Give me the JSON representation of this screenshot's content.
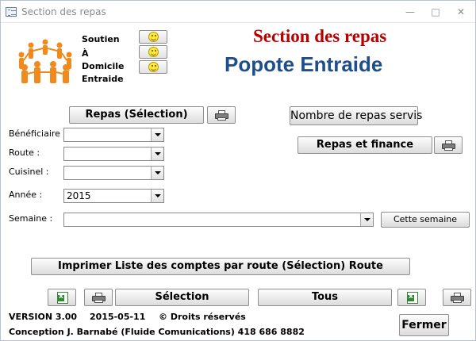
{
  "window": {
    "title": "Section des repas",
    "minimize_glyph": "—",
    "maximize_glyph": "□",
    "close_glyph": "✕"
  },
  "org": {
    "lines": [
      "Soutien",
      "À",
      "Domicile",
      "Entraide"
    ]
  },
  "header": {
    "title": "Section des repas",
    "subtitle": "Popote Entraide"
  },
  "buttons": {
    "repas_selection": "Repas (Sélection)",
    "nombre_repas": "Nombre de repas servis",
    "repas_finance": "Repas et finance",
    "cette_semaine": "Cette semaine",
    "imprimer_liste": "Imprimer Liste des comptes par route (Sélection) Route",
    "selection": "Sélection",
    "tous": "Tous",
    "fermer": "Fermer"
  },
  "filters": {
    "beneficiaire": {
      "label": "Bénéficiaire :",
      "value": ""
    },
    "route": {
      "label": "Route :",
      "value": ""
    },
    "cuisinel": {
      "label": "Cuisinel :",
      "value": ""
    },
    "annee": {
      "label": "Année :",
      "value": "2015"
    },
    "semaine": {
      "label": "Semaine :",
      "value": ""
    }
  },
  "footer": {
    "version": "VERSION 3.00",
    "date": "2015-05-11",
    "rights": "© Droits réservés",
    "credit": "Conception J. Barnabé (Fluide Comunications) 418 686 8882"
  },
  "colors": {
    "title_red": "#b80000",
    "subtitle_blue": "#1f4e8c",
    "logo_orange": "#f08a1c"
  },
  "icons": [
    "smiley-icon",
    "printer-icon",
    "excel-icon",
    "dropdown-arrow-icon",
    "app-form-icon",
    "people-circle-logo"
  ]
}
